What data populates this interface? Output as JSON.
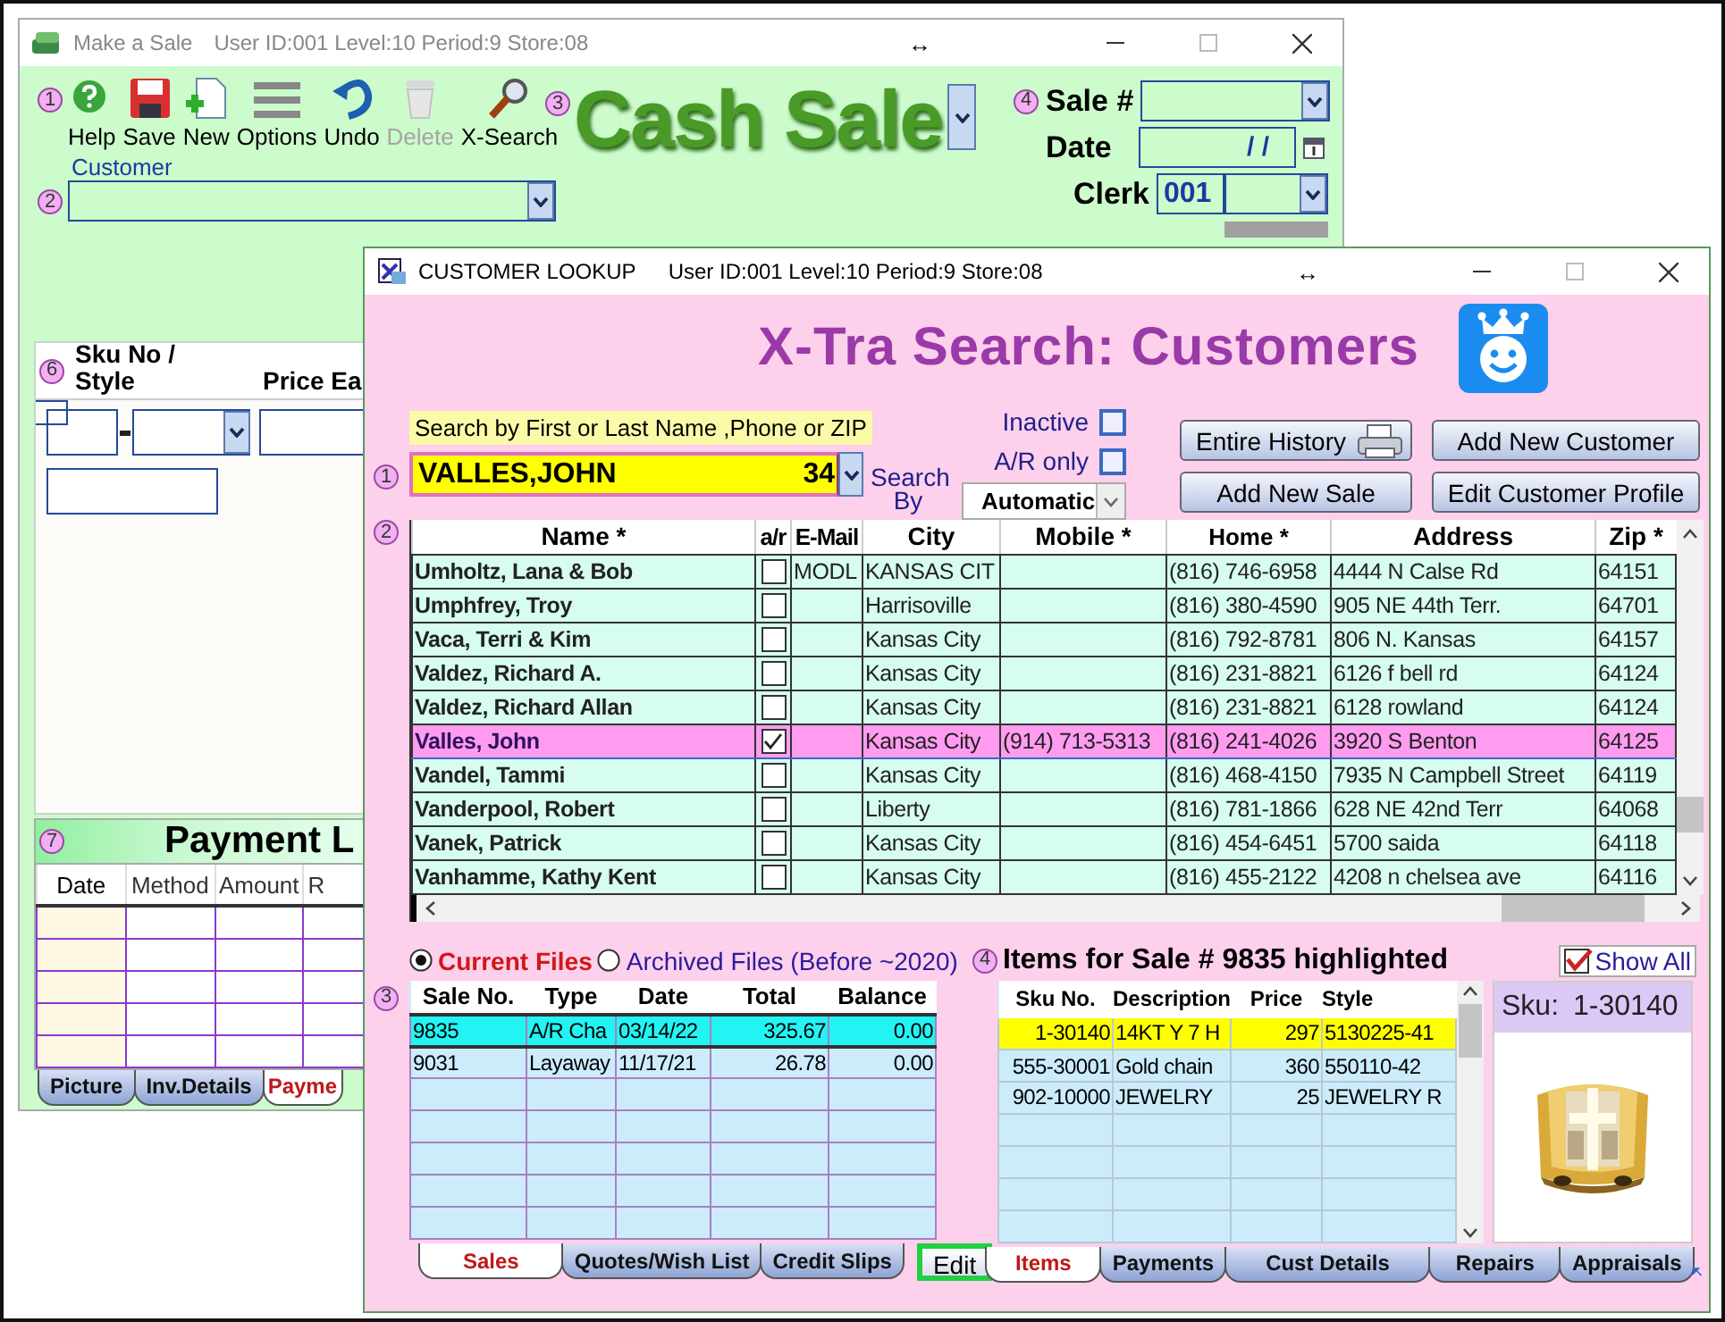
{
  "sale_window": {
    "title": "Make a Sale",
    "session": "User ID:001 Level:10 Period:9 Store:08",
    "resize_glyph": "↔",
    "toolbar_marker": "1",
    "toolbar": [
      {
        "label": "Help",
        "kind": "help",
        "disabled": false
      },
      {
        "label": "Save",
        "kind": "save",
        "disabled": false
      },
      {
        "label": "New",
        "kind": "new",
        "disabled": false
      },
      {
        "label": "Options",
        "kind": "options",
        "disabled": false
      },
      {
        "label": "Undo",
        "kind": "undo",
        "disabled": false
      },
      {
        "label": "Delete",
        "kind": "delete",
        "disabled": true
      },
      {
        "label": "X-Search",
        "kind": "search",
        "disabled": false
      }
    ],
    "heading_marker": "3",
    "heading": "Cash Sale",
    "customer": {
      "marker": "2",
      "label": "Customer"
    },
    "sale_fields": {
      "marker": "4",
      "sale_label": "Sale #",
      "date_label": "Date",
      "date_value": "/ /",
      "clerk_label": "Clerk",
      "clerk_value": "001"
    },
    "items_panel": {
      "marker": "6",
      "sku_header": "Sku No / Style",
      "price_header": "Price Ea"
    },
    "payments": {
      "marker": "7",
      "title": "Payment L",
      "columns": [
        "Date",
        "Method",
        "Amount",
        "R"
      ]
    },
    "tabs": [
      {
        "label": "Picture",
        "selected": false
      },
      {
        "label": "Inv.Details",
        "selected": false
      },
      {
        "label": "Payme",
        "selected": true
      }
    ]
  },
  "lookup_window": {
    "title": "CUSTOMER  LOOKUP",
    "session": "User ID:001 Level:10 Period:9 Store:08",
    "resize_glyph": "↔",
    "heading": "X-Tra Search: Customers",
    "search": {
      "marker": "1",
      "hint": "Search by First or Last Name ,Phone or ZIP",
      "value": "VALLES,JOHN",
      "suffix": "34",
      "by_label": "Search By",
      "mode": "Automatic"
    },
    "filters": [
      {
        "label": "Inactive",
        "checked": false
      },
      {
        "label": "A/R only",
        "checked": false
      }
    ],
    "buttons": [
      {
        "label": "Entire History",
        "kind": "print"
      },
      {
        "label": "Add New Customer",
        "kind": "plain"
      },
      {
        "label": "Add New Sale",
        "kind": "plain"
      },
      {
        "label": "Edit Customer Profile",
        "kind": "plain"
      }
    ],
    "customers": {
      "marker": "2",
      "columns": [
        "Name *",
        "a/r",
        "E-Mail",
        "City",
        "Mobile *",
        "Home *",
        "Address",
        "Zip *"
      ],
      "rows": [
        {
          "name": "Umholtz, Lana & Bob",
          "ar": false,
          "email": "MODL",
          "city": "KANSAS CIT",
          "home": "(816) 746-6958",
          "address": "4444 N Calse Rd",
          "zip": "64151",
          "selected": false
        },
        {
          "name": "Umphfrey, Troy",
          "ar": false,
          "city": "Harrisoville",
          "home": "(816) 380-4590",
          "address": "905 NE 44th Terr.",
          "zip": "64701",
          "selected": false
        },
        {
          "name": "Vaca, Terri & Kim",
          "ar": false,
          "city": "Kansas City",
          "home": "(816) 792-8781",
          "address": "806 N. Kansas",
          "zip": "64157",
          "selected": false
        },
        {
          "name": "Valdez, Richard A.",
          "ar": false,
          "city": "Kansas City",
          "home": "(816) 231-8821",
          "address": "6126 f bell rd",
          "zip": "64124",
          "selected": false
        },
        {
          "name": "Valdez, Richard Allan",
          "ar": false,
          "city": "Kansas City",
          "home": "(816) 231-8821",
          "address": "6128 rowland",
          "zip": "64124",
          "selected": false
        },
        {
          "name": "Valles, John",
          "ar": true,
          "city": "Kansas City",
          "mobile": "(914) 713-5313",
          "home": "(816) 241-4026",
          "address": "3920 S Benton",
          "zip": "64125",
          "selected": true
        },
        {
          "name": "Vandel, Tammi",
          "ar": false,
          "city": "Kansas City",
          "home": "(816) 468-4150",
          "address": "7935 N Campbell Street",
          "zip": "64119",
          "selected": false
        },
        {
          "name": "Vanderpool, Robert",
          "ar": false,
          "city": "Liberty",
          "home": "(816) 781-1866",
          "address": "628 NE 42nd Terr",
          "zip": "64068",
          "selected": false
        },
        {
          "name": "Vanek, Patrick",
          "ar": false,
          "city": "Kansas City",
          "home": "(816) 454-6451",
          "address": "5700 saida",
          "zip": "64118",
          "selected": false
        },
        {
          "name": "Vanhamme, Kathy Kent",
          "ar": false,
          "city": "Kansas City",
          "home": "(816) 455-2122",
          "address": "4208 n chelsea ave",
          "zip": "64116",
          "selected": false
        }
      ]
    },
    "file_scope": [
      {
        "label": "Current Files",
        "selected": true
      },
      {
        "label": "Archived Files (Before ~2020)",
        "selected": false
      }
    ],
    "sales": {
      "marker": "3",
      "columns": [
        "Sale No.",
        "Type",
        "Date",
        "Total",
        "Balance"
      ],
      "rows": [
        {
          "cells": [
            "9835",
            "A/R Cha",
            "03/14/22",
            "325.67",
            "0.00"
          ],
          "selected": true
        },
        {
          "cells": [
            "9031",
            "Layaway",
            "11/17/21",
            "26.78",
            "0.00"
          ],
          "selected": false
        }
      ]
    },
    "sales_tabs": [
      {
        "label": "Sales",
        "selected": true
      },
      {
        "label": "Quotes/Wish List",
        "selected": false
      },
      {
        "label": "Credit Slips",
        "selected": false
      }
    ],
    "edit_button": "Edit",
    "items": {
      "marker": "4",
      "title": "Items for Sale # 9835 highlighted",
      "show_all": {
        "label": "Show All",
        "checked": true
      },
      "columns": [
        "Sku No.",
        "Description",
        "Price",
        "Style"
      ],
      "rows": [
        {
          "cells": [
            "1-30140",
            "14KT Y 7 H",
            "297",
            "5130225-41"
          ],
          "selected": true
        },
        {
          "cells": [
            "555-30001",
            "Gold chain",
            "360",
            "550110-42"
          ],
          "selected": false
        },
        {
          "cells": [
            "902-10000",
            "JEWELRY",
            "25",
            "JEWELRY R"
          ],
          "selected": false
        }
      ],
      "preview_label": "Sku:",
      "preview_value": "1-30140"
    },
    "item_tabs": [
      {
        "label": "Items",
        "selected": true
      },
      {
        "label": "Payments",
        "selected": false
      },
      {
        "label": "Cust Details",
        "selected": false
      },
      {
        "label": "Repairs",
        "selected": false
      },
      {
        "label": "Appraisals",
        "selected": false
      }
    ]
  }
}
